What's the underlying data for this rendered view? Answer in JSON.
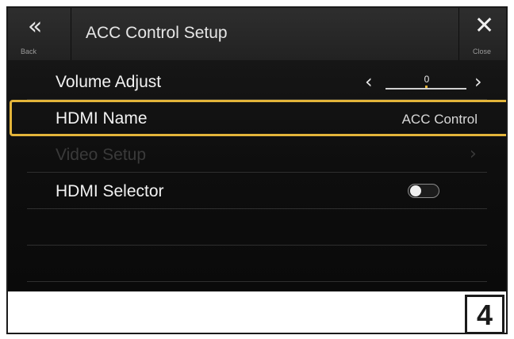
{
  "header": {
    "title": "ACC Control Setup",
    "back_icon": "double-chevron-left-icon",
    "back_glyph": "«",
    "back_label": "Back",
    "close_icon": "close-icon",
    "close_glyph": "✕",
    "close_label": "Close"
  },
  "rows": {
    "volume": {
      "label": "Volume Adjust",
      "value": "0",
      "left_glyph": "‹",
      "right_glyph": "›",
      "level_fraction": 0.5
    },
    "hdmi_name": {
      "label": "HDMI Name",
      "value": "ACC Control",
      "selected": true
    },
    "video": {
      "label": "Video Setup",
      "chevron": "›",
      "enabled": false
    },
    "selector": {
      "label": "HDMI Selector",
      "toggle_on": false
    }
  },
  "page_badge": "4",
  "colors": {
    "highlight": "#e3b43a",
    "background": "#111111",
    "text": "#f2f2f2",
    "disabled_text": "#3a3a3a"
  }
}
